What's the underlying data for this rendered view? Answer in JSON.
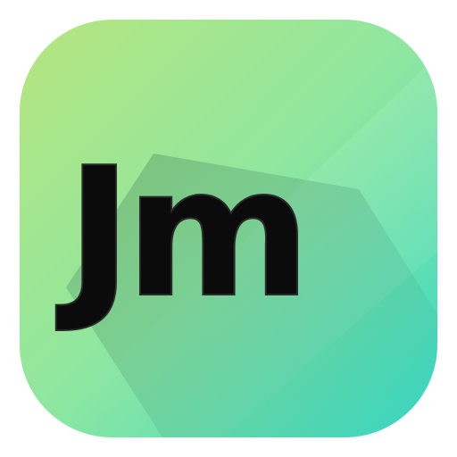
{
  "app_icon": {
    "monogram": "Jm",
    "colors": {
      "gradient_top_left": "#b7e57f",
      "gradient_mid": "#8ee7a0",
      "gradient_bottom_right": "#36d7c4",
      "letter_fill": "#0b0b0b",
      "long_shadow": "#1f5a45"
    }
  }
}
